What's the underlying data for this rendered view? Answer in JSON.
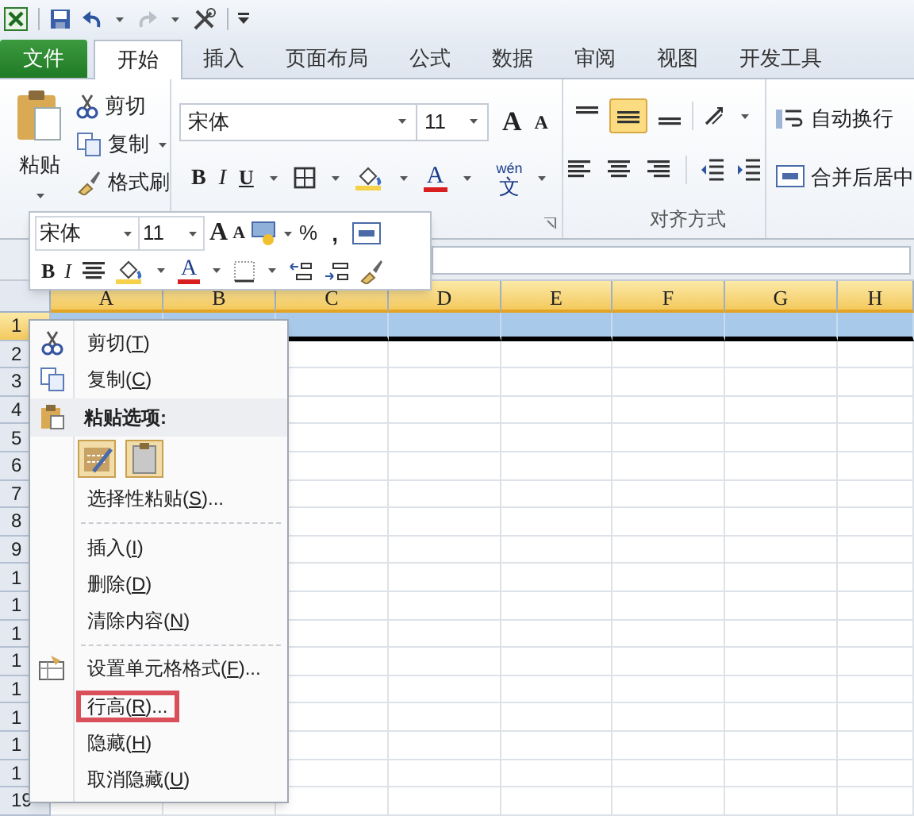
{
  "tabs": [
    {
      "label": "文件",
      "kind": "file",
      "selected": false
    },
    {
      "label": "开始",
      "kind": "tab",
      "selected": true
    },
    {
      "label": "插入",
      "kind": "tab",
      "selected": false
    },
    {
      "label": "页面布局",
      "kind": "tab",
      "selected": false
    },
    {
      "label": "公式",
      "kind": "tab",
      "selected": false
    },
    {
      "label": "数据",
      "kind": "tab",
      "selected": false
    },
    {
      "label": "审阅",
      "kind": "tab",
      "selected": false
    },
    {
      "label": "视图",
      "kind": "tab",
      "selected": false
    },
    {
      "label": "开发工具",
      "kind": "tab",
      "selected": false
    }
  ],
  "ribbon": {
    "clipboard": {
      "paste": "粘贴",
      "items": [
        "剪切",
        "复制",
        "格式刷"
      ]
    },
    "font": {
      "font_name": "宋体",
      "font_size": "11",
      "grow": "A",
      "shrink": "A",
      "bold": "B",
      "italic": "I",
      "underline": "U",
      "font_color": "A",
      "phonetic_top": "wén",
      "phonetic_bottom": "文"
    },
    "alignment": {
      "label": "对齐方式",
      "wrap_text": "自动换行",
      "merge_center": "合并后居中"
    }
  },
  "mini_toolbar": {
    "font_name": "宋体",
    "font_size": "11",
    "grow": "A",
    "shrink": "A",
    "percent": "%",
    "comma": ",",
    "bold": "B",
    "italic": "I",
    "font_color": "A"
  },
  "sheet": {
    "columns": [
      {
        "label": "A"
      },
      {
        "label": "B"
      },
      {
        "label": "C"
      },
      {
        "label": "D"
      },
      {
        "label": "E"
      },
      {
        "label": "F"
      },
      {
        "label": "G"
      },
      {
        "label": "H"
      }
    ],
    "rows": [
      {
        "label": "1",
        "selected": true
      },
      {
        "label": "2",
        "selected": false
      },
      {
        "label": "3",
        "selected": false
      },
      {
        "label": "4",
        "selected": false
      },
      {
        "label": "5",
        "selected": false
      },
      {
        "label": "6",
        "selected": false
      },
      {
        "label": "7",
        "selected": false
      },
      {
        "label": "8",
        "selected": false
      },
      {
        "label": "9",
        "selected": false
      },
      {
        "label": "1",
        "selected": false
      },
      {
        "label": "1",
        "selected": false
      },
      {
        "label": "1",
        "selected": false
      },
      {
        "label": "1",
        "selected": false
      },
      {
        "label": "1",
        "selected": false
      },
      {
        "label": "1",
        "selected": false
      },
      {
        "label": "1",
        "selected": false
      },
      {
        "label": "1",
        "selected": false
      },
      {
        "label": "19",
        "selected": false
      }
    ]
  },
  "context_menu": [
    {
      "kind": "item",
      "pre": "剪切(",
      "key": "T",
      "post": ")",
      "highlighted": false
    },
    {
      "kind": "item",
      "pre": "复制(",
      "key": "C",
      "post": ")",
      "highlighted": false
    },
    {
      "kind": "heading",
      "pre": "粘贴选项:"
    },
    {
      "kind": "paste_icons"
    },
    {
      "kind": "item",
      "pre": "选择性粘贴(",
      "key": "S",
      "post": ")...",
      "highlighted": false
    },
    {
      "kind": "separator"
    },
    {
      "kind": "item",
      "pre": "插入(",
      "key": "I",
      "post": ")",
      "highlighted": false
    },
    {
      "kind": "item",
      "pre": "删除(",
      "key": "D",
      "post": ")",
      "highlighted": false
    },
    {
      "kind": "item",
      "pre": "清除内容(",
      "key": "N",
      "post": ")",
      "highlighted": false
    },
    {
      "kind": "separator"
    },
    {
      "kind": "item",
      "pre": "设置单元格格式(",
      "key": "F",
      "post": ")...",
      "highlighted": false
    },
    {
      "kind": "item",
      "pre": "行高(",
      "key": "R",
      "post": ")...",
      "highlighted": true
    },
    {
      "kind": "item",
      "pre": "隐藏(",
      "key": "H",
      "post": ")",
      "highlighted": false
    },
    {
      "kind": "item",
      "pre": "取消隐藏(",
      "key": "U",
      "post": ")",
      "highlighted": false
    }
  ]
}
